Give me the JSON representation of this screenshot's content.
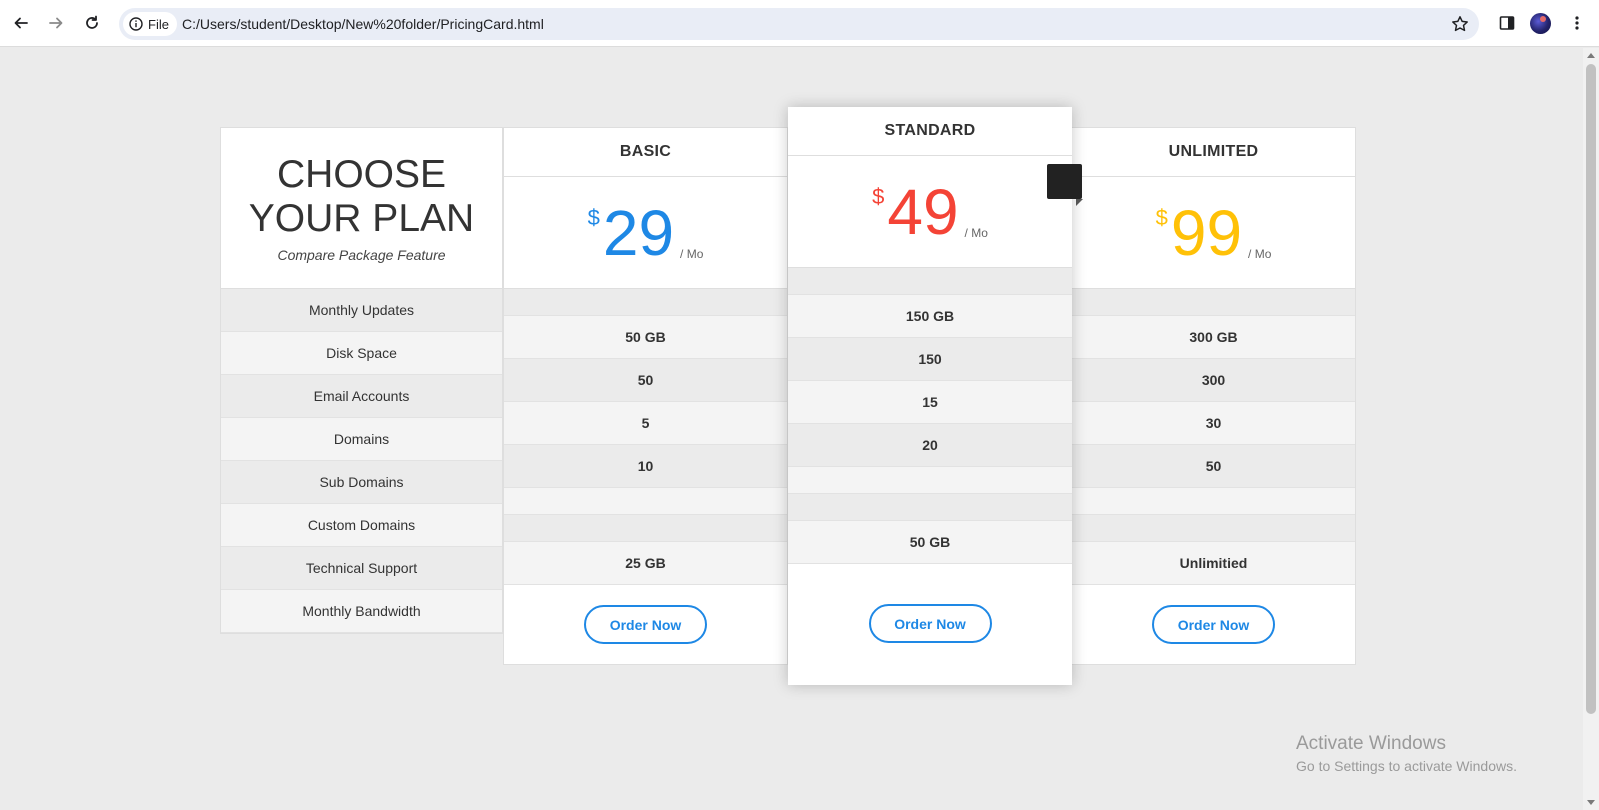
{
  "browser": {
    "file_chip_label": "File",
    "url": "C:/Users/student/Desktop/New%20folder/PricingCard.html"
  },
  "page": {
    "title_line1": "CHOOSE",
    "title_line2": "YOUR PLAN",
    "subtitle": "Compare Package Feature",
    "features": [
      "Monthly Updates",
      "Disk Space",
      "Email Accounts",
      "Domains",
      "Sub Domains",
      "Custom Domains",
      "Technical Support",
      "Monthly Bandwidth"
    ]
  },
  "plans": {
    "basic": {
      "name": "BASIC",
      "currency": "$",
      "price": "29",
      "period": "/ Mo",
      "color": "#1e88e5",
      "values": [
        "",
        "50 GB",
        "50",
        "5",
        "10",
        "",
        "",
        "25 GB"
      ],
      "button": "Order Now"
    },
    "standard": {
      "name": "STANDARD",
      "currency": "$",
      "price": "49",
      "period": "/ Mo",
      "color": "#f44336",
      "values": [
        "",
        "150 GB",
        "150",
        "15",
        "20",
        "",
        "",
        "50 GB"
      ],
      "button": "Order Now"
    },
    "unlimited": {
      "name": "UNLIMITED",
      "currency": "$",
      "price": "99",
      "period": "/ Mo",
      "color": "#ffc107",
      "values": [
        "",
        "300 GB",
        "300",
        "30",
        "50",
        "",
        "",
        "Unlimitied"
      ],
      "button": "Order Now"
    }
  },
  "watermark": {
    "title": "Activate Windows",
    "subtitle": "Go to Settings to activate Windows."
  }
}
